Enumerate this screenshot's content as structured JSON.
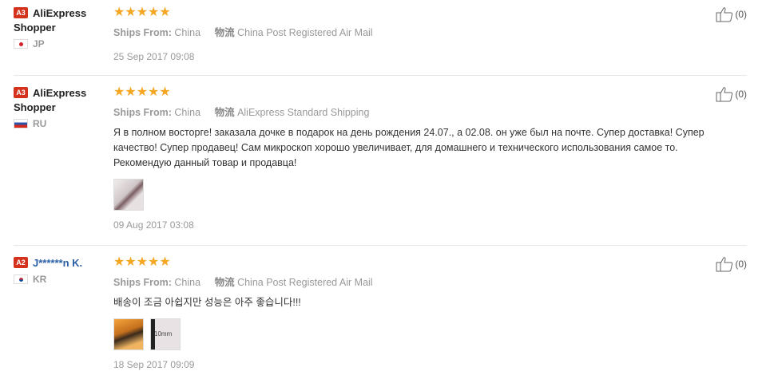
{
  "labels": {
    "ships_from": "Ships From:",
    "logistics": "物流"
  },
  "reviews": [
    {
      "badge": "A3",
      "name": "AliExpress Shopper",
      "country": "JP",
      "rating": 5,
      "stars": "★★★★★",
      "ships_from": "China",
      "shipping": "China Post Registered Air Mail",
      "text": "",
      "photos": [],
      "date": "25 Sep 2017 09:08",
      "likes": "(0)"
    },
    {
      "badge": "A3",
      "name": "AliExpress Shopper",
      "country": "RU",
      "rating": 5,
      "stars": "★★★★★",
      "ships_from": "China",
      "shipping": "AliExpress Standard Shipping",
      "text": "Я в полном восторге! заказала дочке в подарок на день рождения 24.07., а 02.08. он уже был на почте. Супер доставка! Супер качество! Супер продавец! Сам микроскоп хорошо увеличивает, для домашнего и технического использования самое то. Рекомендую данный товар и продавца!",
      "photos": [
        "photo-1"
      ],
      "date": "09 Aug 2017 03:08",
      "likes": "(0)"
    },
    {
      "badge": "A2",
      "name": "J******n K.",
      "country": "KR",
      "rating": 5,
      "stars": "★★★★★",
      "ships_from": "China",
      "shipping": "China Post Registered Air Mail",
      "text": "배송이 조금 아쉽지만 성능은 아주 좋습니다!!!",
      "photos": [
        "photo-1",
        "photo-2"
      ],
      "photo2_caption": "10mm",
      "date": "18 Sep 2017 09:09",
      "likes": "(0)"
    }
  ],
  "colors": {
    "star": "#f5a623",
    "badge": "#d4321d",
    "link_name": "#2a5fa8"
  }
}
